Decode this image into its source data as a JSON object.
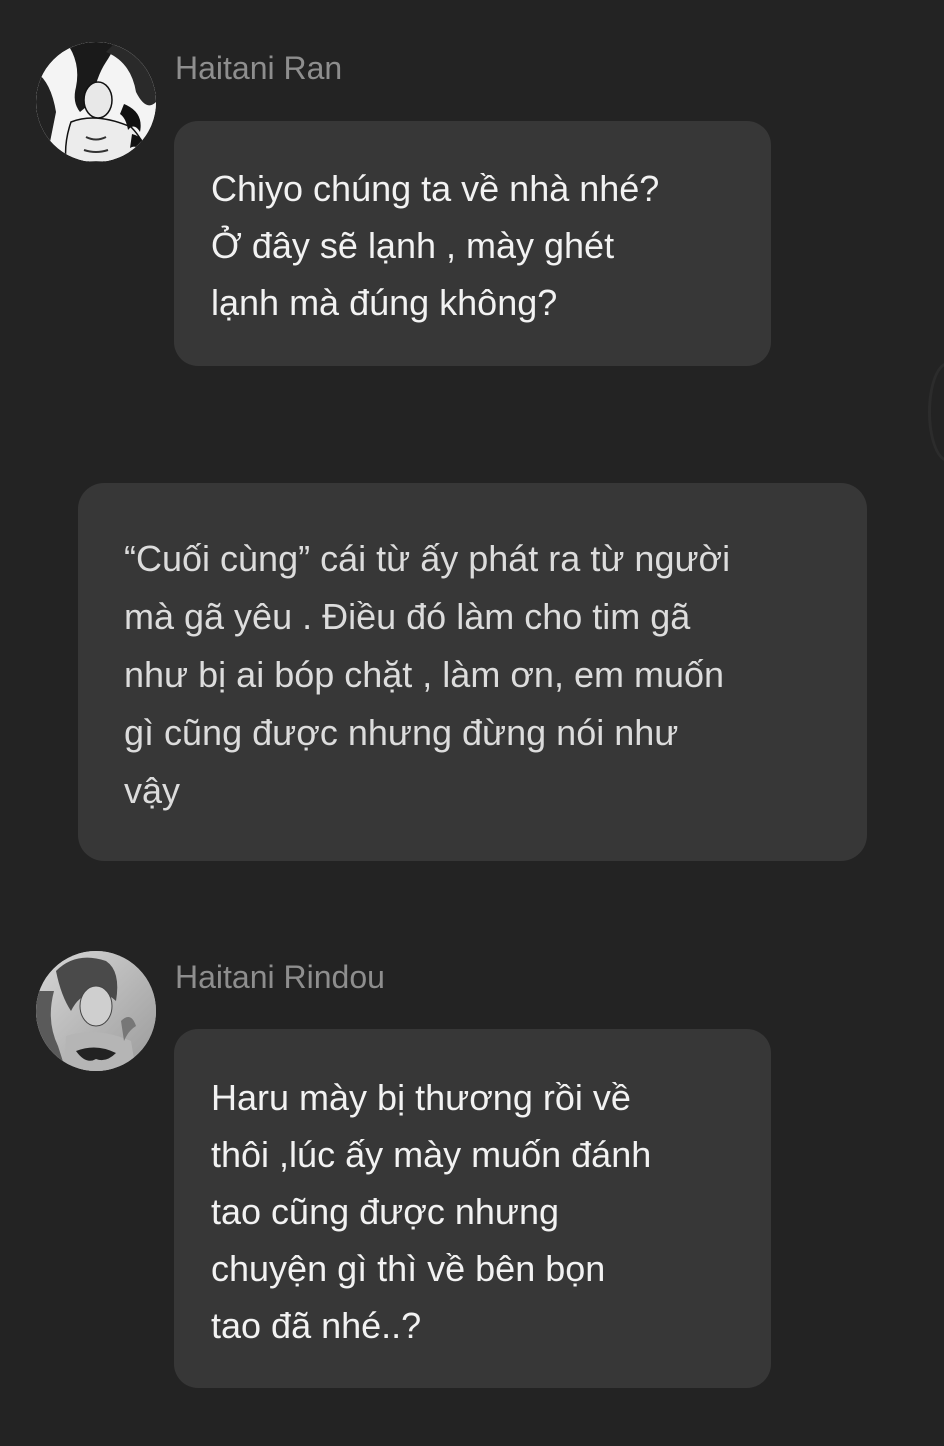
{
  "messages": [
    {
      "sender": "Haitani Ran",
      "avatar_icon": "character-avatar-icon",
      "text": "Chiyo chúng ta về nhà nhé?\nỞ đây sẽ lạnh , mày ghét\nlạnh mà đúng không?"
    },
    {
      "narration": "“Cuối cùng” cái từ ấy phát ra từ người\nmà gã yêu . Điều đó làm cho tim gã\nnhư bị ai bóp chặt , làm ơn, em muốn\ngì cũng được nhưng đừng nói như\nvậy"
    },
    {
      "sender": "Haitani Rindou",
      "avatar_icon": "character-avatar-icon",
      "text": "Haru mày bị thương rồi về\nthôi ,lúc ấy mày muốn đánh\ntao cũng được nhưng\nchuyện gì thì về bên bọn\ntao đã nhé..?"
    }
  ],
  "colors": {
    "background": "#232323",
    "bubble": "#373737",
    "name": "#8e8e8e",
    "text": "#f2f2f2"
  }
}
